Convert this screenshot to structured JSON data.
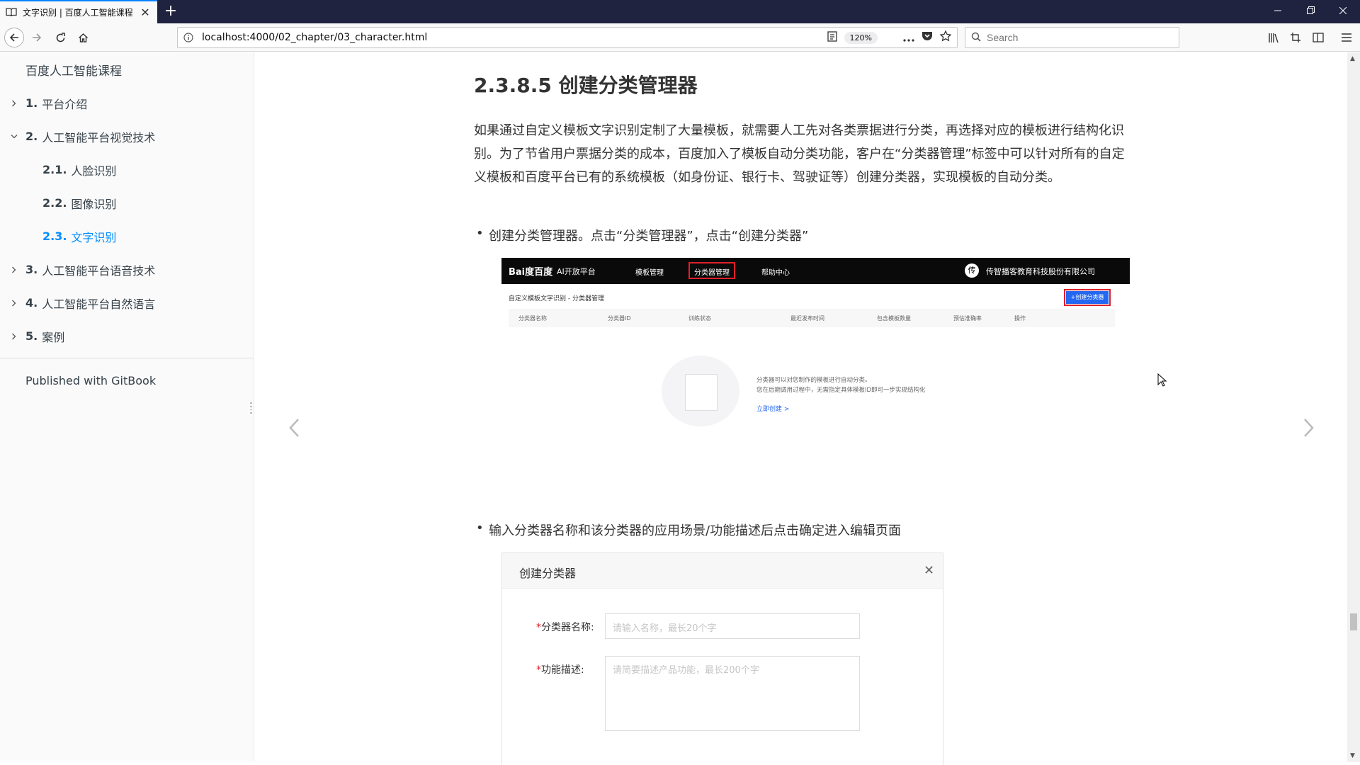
{
  "browser": {
    "tab_title": "文字识别 | 百度人工智能课程",
    "url": "localhost:4000/02_chapter/03_character.html",
    "zoom": "120%",
    "search_placeholder": "Search",
    "tab_close_glyph": "✕",
    "new_tab_glyph": "+"
  },
  "sidebar": {
    "title": "百度人工智能课程",
    "items": [
      {
        "num": "1.",
        "label": "平台介绍",
        "expanded": false
      },
      {
        "num": "2.",
        "label": "人工智能平台视觉技术",
        "expanded": true
      },
      {
        "num": "2.1.",
        "label": "人脸识别"
      },
      {
        "num": "2.2.",
        "label": "图像识别"
      },
      {
        "num": "2.3.",
        "label": "文字识别",
        "active": true
      },
      {
        "num": "3.",
        "label": "人工智能平台语音技术",
        "expanded": false
      },
      {
        "num": "4.",
        "label": "人工智能平台自然语言",
        "expanded": false
      },
      {
        "num": "5.",
        "label": "案例",
        "expanded": false
      }
    ],
    "footer": "Published with GitBook"
  },
  "content": {
    "heading": "2.3.8.5 创建分类管理器",
    "paragraph": "如果通过自定义模板文字识别定制了大量模板，就需要人工先对各类票据进行分类，再选择对应的模板进行结构化识别。为了节省用户票据分类的成本，百度加入了模板自动分类功能，客户在“分类器管理”标签中可以针对所有的自定义模板和百度平台已有的系统模板（如身份证、银行卡、驾驶证等）创建分类器，实现模板的自动分类。",
    "bullet1": "创建分类管理器。点击“分类管理器”，点击“创建分类器”",
    "bullet2": "输入分类器名称和该分类器的应用场景/功能描述后点击确定进入编辑页面"
  },
  "shot1": {
    "logo": "Bai度百度",
    "logo2": "AI开放平台",
    "nav": [
      "模板管理",
      "分类器管理",
      "帮助中心"
    ],
    "avatar": "传",
    "company": "传智播客教育科技股份有限公司",
    "breadcrumb": "自定义模板文字识别 - 分类器管理",
    "create_button": "+创建分类器",
    "columns": [
      "分类器名称",
      "分类器ID",
      "训练状态",
      "最近发布时间",
      "包含模板数量",
      "预估准确率",
      "操作"
    ],
    "empty_line1": "分类器可以对您制作的模板进行自动分类。",
    "empty_line2": "您在后期调用过程中，无需指定具体模板ID即可一步实现结构化",
    "empty_link": "立即创建 >"
  },
  "shot2": {
    "title": "创建分类器",
    "close": "✕",
    "name_label": "分类器名称:",
    "name_placeholder": "请输入名称，最长20个字",
    "desc_label": "功能描述:",
    "desc_placeholder": "请简要描述产品功能，最长200个字",
    "required_mark": "*"
  },
  "colors": {
    "accent_link": "#008cff",
    "titlebar": "#202340",
    "highlight_red": "#e0202a",
    "baidu_blue": "#2468f2"
  }
}
